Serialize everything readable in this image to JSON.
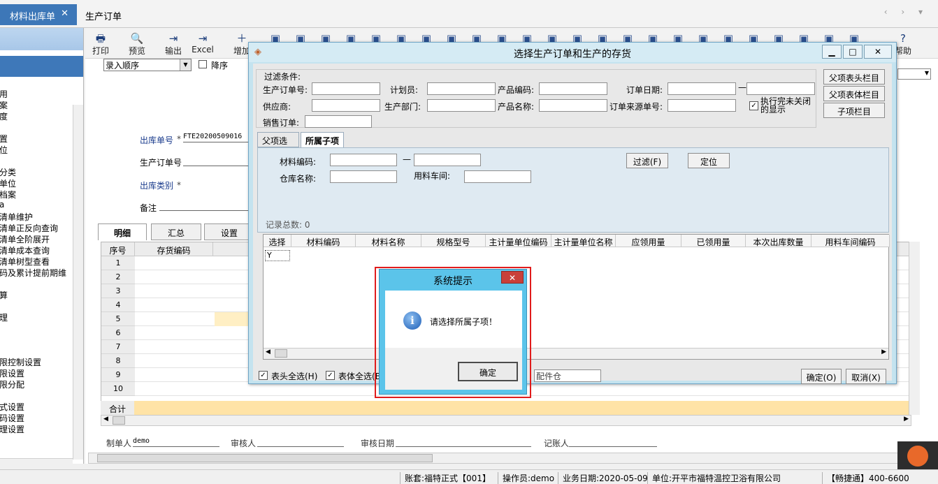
{
  "tabs": {
    "active": "材料出库单",
    "close": "✕",
    "second": "生产订单",
    "nav": "‹ › ▾"
  },
  "left_nav": [
    "用",
    "案",
    "度",
    "",
    "置",
    "位",
    "分类",
    "单位",
    "档案",
    "a",
    "清单维护",
    "清单正反向查询",
    "清单全阶展开",
    "清单成本查询",
    "清单树型查看",
    "码及累计提前期维",
    "",
    "算",
    "",
    "理",
    "",
    "",
    "限控制设置",
    "限设置",
    "限分配",
    "",
    "式设置",
    "码设置",
    "理设置"
  ],
  "toolbar": [
    {
      "icon": "printer-icon",
      "glyph": "🖶",
      "label": "打印"
    },
    {
      "icon": "preview-icon",
      "glyph": "🔍",
      "label": "预览"
    },
    {
      "icon": "export-icon",
      "glyph": "⇥",
      "label": "输出"
    },
    {
      "icon": "excel-icon",
      "glyph": "⇥",
      "label": "Excel"
    },
    {
      "icon": "add-icon",
      "glyph": "＋",
      "label": "增加"
    },
    {
      "icon": "help-icon",
      "glyph": "?",
      "label": "帮助"
    }
  ],
  "form": {
    "sort_select": "录入顺序",
    "desc_label": "降序",
    "out_no_label": "出库单号",
    "out_no_value": "FTE20200509016",
    "prod_order_label": "生产订单号",
    "out_type_label": "出库类别",
    "remark_label": "备注",
    "required_mark": "*"
  },
  "subtabs": [
    "明细",
    "汇总",
    "设置"
  ],
  "grid": {
    "headers": [
      "序号",
      "存货编码"
    ],
    "rows": [
      "1",
      "2",
      "3",
      "4",
      "5",
      "6",
      "7",
      "8",
      "9",
      "10"
    ],
    "sum_label": "合计"
  },
  "signatures": {
    "maker": "制单人",
    "maker_value": "demo",
    "reviewer": "审核人",
    "review_date": "审核日期",
    "bookkeeper": "记账人"
  },
  "status": {
    "account": "账套:福特正式【001】",
    "operator": "操作员:demo",
    "date": "业务日期:2020-05-09",
    "unit": "单位:开平市福特温控卫浴有限公司",
    "hotline": "【畅捷通】400-6600"
  },
  "dialog": {
    "title": "选择生产订单和生产的存货",
    "win_buttons": [
      "▁",
      "□",
      "✕"
    ],
    "filter_legend": "过滤条件:",
    "fields": {
      "prod_order_no": "生产订单号:",
      "planner": "计划员:",
      "product_code": "产品编码:",
      "order_date": "订单日期:",
      "supplier": "供应商:",
      "prod_dept": "生产部门:",
      "product_name": "产品名称:",
      "order_source_no": "订单来源单号:",
      "sales_order": "销售订单:"
    },
    "close_after_exec": "执行完未关闭的显示",
    "right_buttons": [
      "父项表头栏目",
      "父项表体栏目",
      "子项栏目"
    ],
    "inner_tabs": [
      "父项选择",
      "所属子项"
    ],
    "material_code": "材料编码:",
    "warehouse_name": "仓库名称:",
    "workshop": "用料车间:",
    "filter_btn": "过滤(F)",
    "locate_btn": "定位",
    "record_count": "记录总数: 0",
    "grid_headers": [
      "选择",
      "材料编码",
      "材料名称",
      "规格型号",
      "主计量单位编码",
      "主计量单位名称",
      "应领用量",
      "已领用量",
      "本次出库数量",
      "用料车间编码"
    ],
    "first_cell": "Y",
    "head_select_all": "表头全选(H)",
    "body_select_all": "表体全选(B",
    "warehouse_value": "配件仓",
    "ok_btn": "确定(O)",
    "cancel_btn": "取消(X)"
  },
  "msgbox": {
    "title": "系统提示",
    "close": "✕",
    "icon_glyph": "i",
    "message": "请选择所属子项！",
    "ok": "确定"
  }
}
